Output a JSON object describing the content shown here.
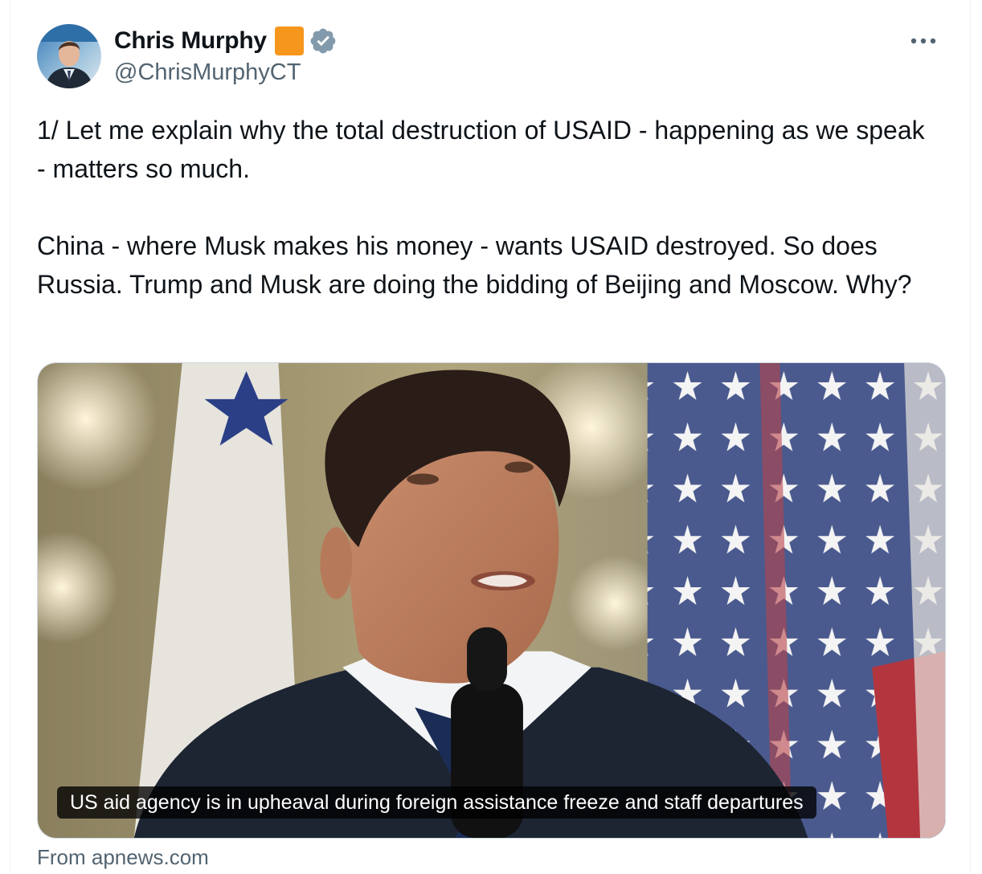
{
  "author": {
    "display_name": "Chris Murphy",
    "handle": "@ChrisMurphyCT",
    "avatar_icon": "avatar-photo",
    "affiliation_badge_color": "#f7961d",
    "verified_icon": "verified-badge-icon",
    "verified_color": "#829aab"
  },
  "post": {
    "text": "1/ Let me explain why the total destruction of USAID - happening as we speak - matters so much.\n\nChina - where Musk makes his money - wants USAID destroyed. So does Russia. Trump and Musk are doing the bidding of Beijing and Moscow. Why?",
    "more_icon": "more-options-icon"
  },
  "link_card": {
    "caption": "US aid agency is in upheaval during foreign assistance freeze and staff departures",
    "source": "From apnews.com"
  }
}
